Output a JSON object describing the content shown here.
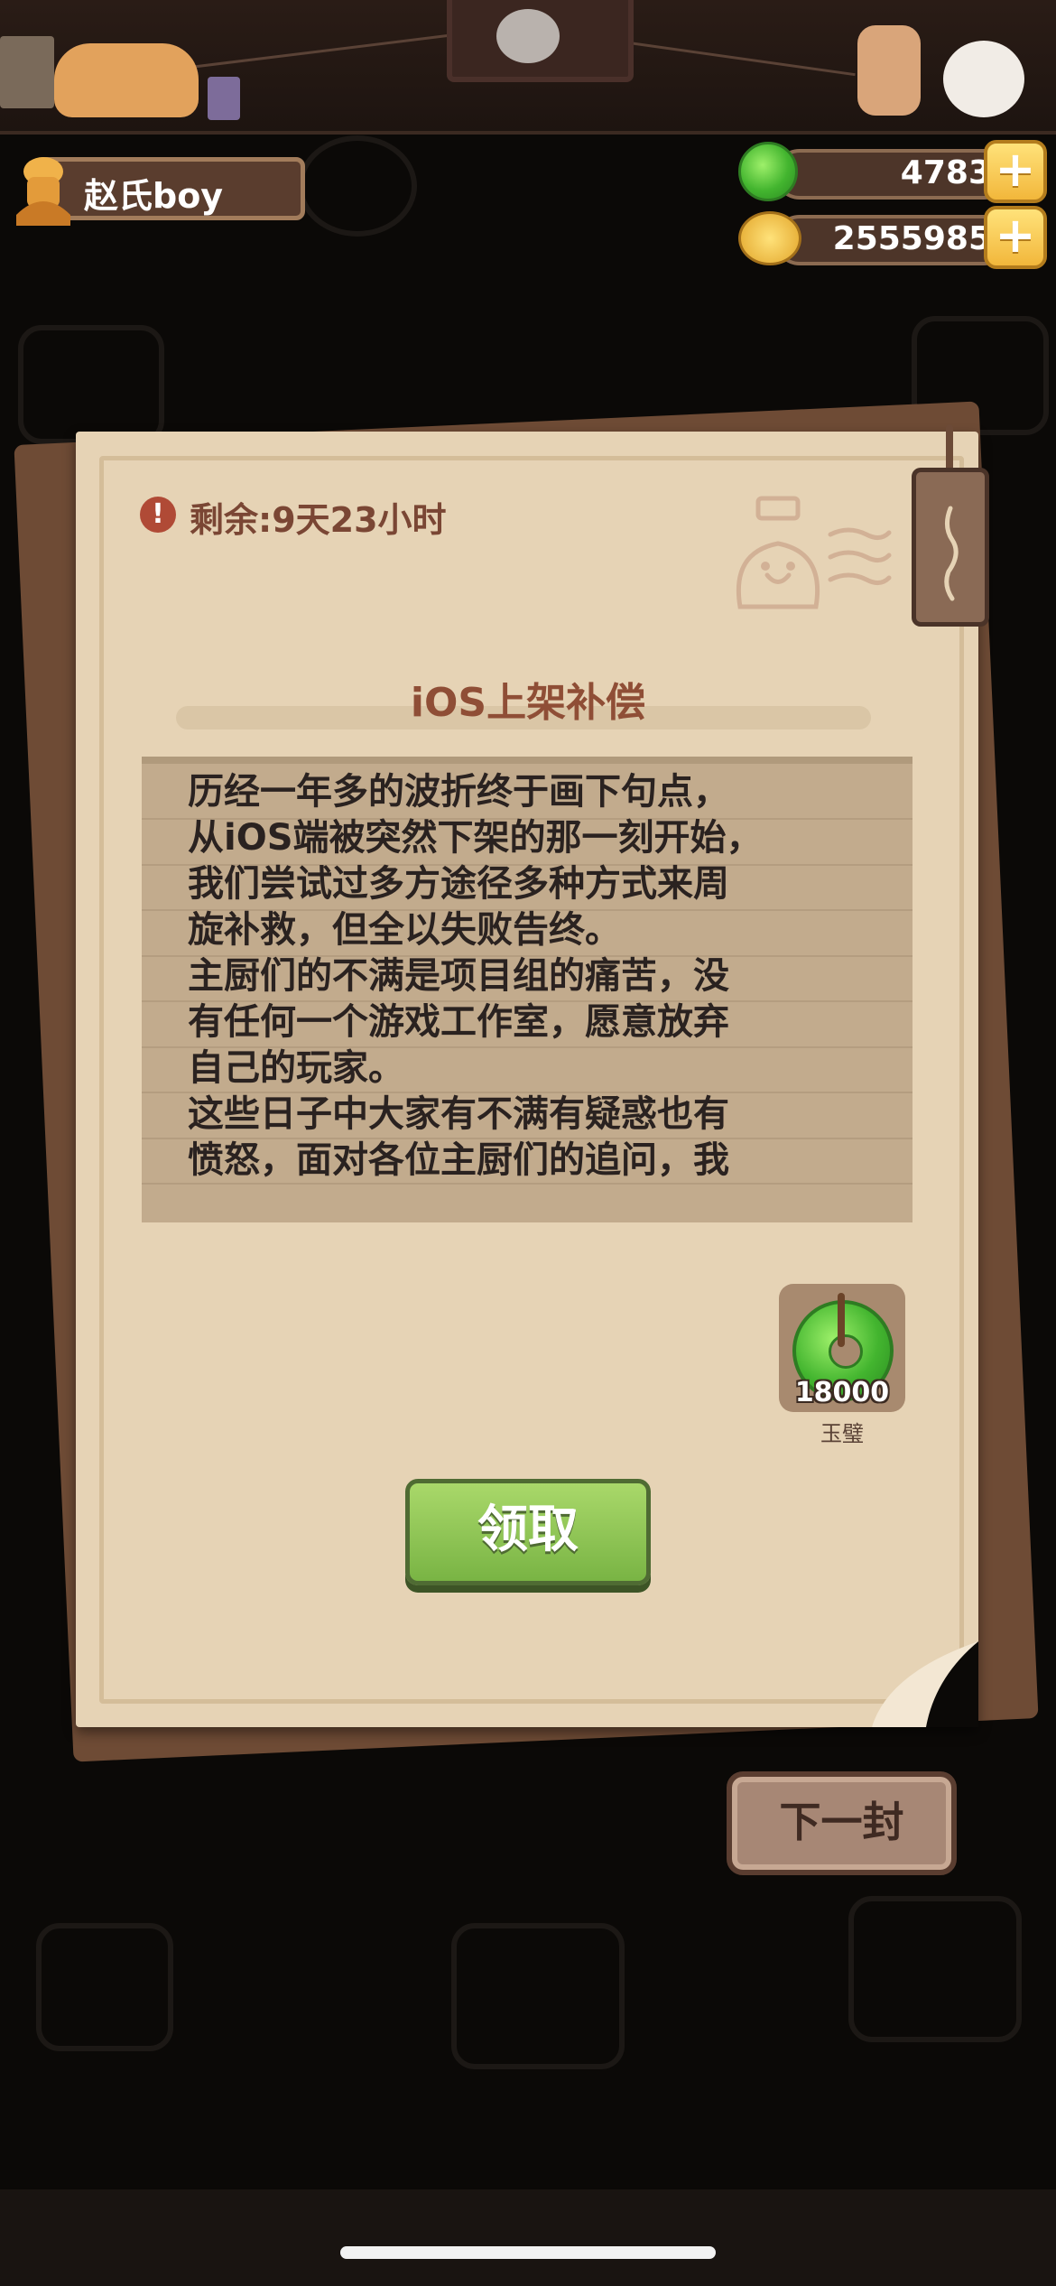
{
  "player": {
    "name": "赵氏boy"
  },
  "currency": {
    "jade_amount": "4783",
    "coin_amount": "2555985",
    "plus_label": "+"
  },
  "mail": {
    "remaining_label": "剩余:9天23小时",
    "title": "iOS上架补偿",
    "body": "历经一年多的波折终于画下句点，\n从iOS端被突然下架的那一刻开始，\n我们尝试过多方途径多种方式来周\n旋补救，但全以失败告终。\n主厨们的不满是项目组的痛苦，没\n有任何一个游戏工作室，愿意放弃\n自己的玩家。\n这些日子中大家有不满有疑惑也有\n愤怒，面对各位主厨们的追问，我",
    "reward": {
      "count": "18000",
      "name": "玉璧",
      "icon": "jade-disc-icon"
    },
    "claim_label": "领取",
    "next_label": "下一封"
  },
  "colors": {
    "paper": "#e6d3b5",
    "claim_green": "#8ec457",
    "title_brown": "#8f4e36"
  }
}
